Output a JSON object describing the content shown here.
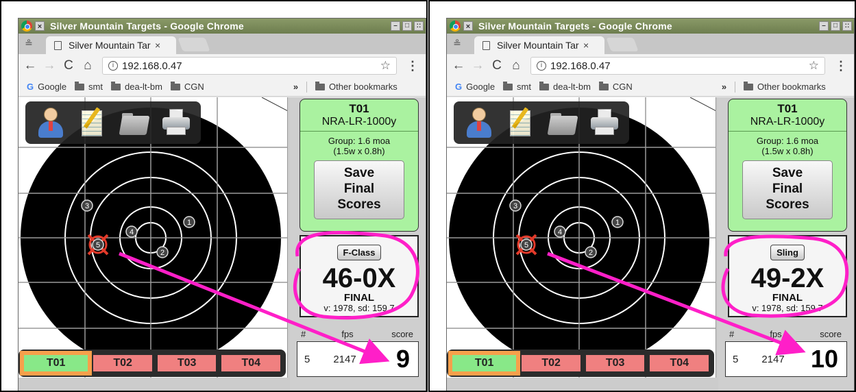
{
  "panels": [
    {
      "window_title": "Silver Mountain Targets - Google Chrome",
      "tab_title": "Silver Mountain Targ",
      "url": "192.168.0.47",
      "bookmarks": {
        "google": "Google",
        "folders": [
          "smt",
          "dea-lt-bm",
          "CGN"
        ],
        "other": "Other bookmarks",
        "chevron": "»"
      },
      "card": {
        "target_id": "T01",
        "course": "NRA-LR-1000y",
        "group": "Group: 1.6 moa",
        "group_dims": "(1.5w x 0.8h)",
        "save_lines": [
          "Save",
          "Final",
          "Scores"
        ]
      },
      "score": {
        "class_label": "F-Class",
        "total": "46-0X",
        "status": "FINAL",
        "stats": "v: 1978, sd: 159.7"
      },
      "shots_table": {
        "headers": [
          "#",
          "fps",
          "score"
        ],
        "row": {
          "num": "5",
          "fps": "2147",
          "score": "9"
        }
      },
      "target_tabs": [
        "T01",
        "T02",
        "T03",
        "T04"
      ],
      "shot_markers": [
        "1",
        "2",
        "3",
        "4",
        "5"
      ],
      "colors": {
        "highlight": "#ff1fc8",
        "card": "#aaf2a0",
        "active_tab": "#88e888",
        "inactive_tab": "#f08080"
      }
    },
    {
      "window_title": "Silver Mountain Targets - Google Chrome",
      "tab_title": "Silver Mountain Targ",
      "url": "192.168.0.47",
      "bookmarks": {
        "google": "Google",
        "folders": [
          "smt",
          "dea-lt-bm",
          "CGN"
        ],
        "other": "Other bookmarks",
        "chevron": "»"
      },
      "card": {
        "target_id": "T01",
        "course": "NRA-LR-1000y",
        "group": "Group: 1.6 moa",
        "group_dims": "(1.5w x 0.8h)",
        "save_lines": [
          "Save",
          "Final",
          "Scores"
        ]
      },
      "score": {
        "class_label": "Sling",
        "total": "49-2X",
        "status": "FINAL",
        "stats": "v: 1978, sd: 159.7"
      },
      "shots_table": {
        "headers": [
          "#",
          "fps",
          "score"
        ],
        "row": {
          "num": "5",
          "fps": "2147",
          "score": "10"
        }
      },
      "target_tabs": [
        "T01",
        "T02",
        "T03",
        "T04"
      ],
      "shot_markers": [
        "1",
        "2",
        "3",
        "4",
        "5"
      ],
      "colors": {
        "highlight": "#ff1fc8",
        "card": "#aaf2a0",
        "active_tab": "#88e888",
        "inactive_tab": "#f08080"
      }
    }
  ]
}
